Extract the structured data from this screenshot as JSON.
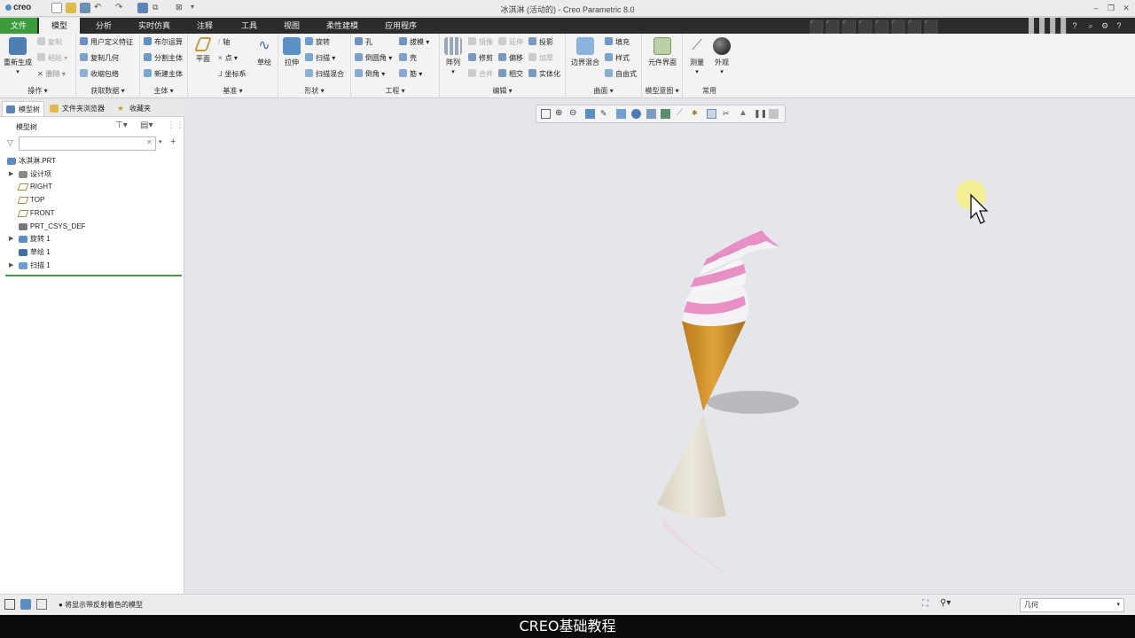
{
  "app": {
    "logo": "creo",
    "window_title": "冰淇淋 (活动的) - Creo Parametric 8.0"
  },
  "tabs": [
    "文件",
    "模型",
    "分析",
    "实时仿真",
    "注释",
    "工具",
    "视图",
    "柔性建模",
    "应用程序"
  ],
  "ribbon": {
    "operations": {
      "label": "操作",
      "regen": "重新生成",
      "copy": "复制",
      "paste": "粘贴",
      "delete": "删除"
    },
    "getdata": {
      "label": "获取数据",
      "udf": "用户定义特征",
      "copygeom": "复制几何",
      "shrinkwrap": "收缩包络"
    },
    "body": {
      "label": "主体",
      "boolean": "布尔运算",
      "split": "分割主体",
      "newbody": "新建主体"
    },
    "datum": {
      "label": "基准",
      "plane": "平面",
      "axis": "轴",
      "point": "点",
      "csys": "坐标系",
      "sketch": "草绘"
    },
    "shapes": {
      "label": "形状",
      "extrude": "拉伸",
      "revolve": "旋转",
      "sweep": "扫描",
      "swept_blend": "扫描混合"
    },
    "engineering": {
      "label": "工程",
      "hole": "孔",
      "round": "倒圆角",
      "chamfer": "倒角",
      "draft": "拔模",
      "shell": "壳",
      "rib": "筋"
    },
    "editing": {
      "label": "编辑",
      "pattern": "阵列",
      "mirror": "镜像",
      "extend": "延伸",
      "project": "投影",
      "trim": "修剪",
      "offset": "偏移",
      "thicken": "加厚",
      "merge": "合并",
      "intersect": "相交",
      "solidify": "实体化"
    },
    "surfaces": {
      "label": "曲面",
      "boundary": "边界混合",
      "fill": "填充",
      "style": "样式",
      "freestyle": "自由式"
    },
    "intent": {
      "label": "模型意图",
      "component_interface": "元件界面"
    },
    "common": {
      "label": "常用",
      "measure": "测量",
      "appearance": "外观"
    }
  },
  "panel": {
    "tabs": [
      "模型树",
      "文件夹浏览器",
      "收藏夹"
    ],
    "tree_title": "模型树",
    "search_value": "",
    "items": [
      {
        "label": "冰淇淋.PRT",
        "expandable": false,
        "icon": "part-icon"
      },
      {
        "label": "设计项",
        "expandable": true,
        "icon": "design-items-icon"
      },
      {
        "label": "RIGHT",
        "expandable": false,
        "icon": "datum-plane-icon"
      },
      {
        "label": "TOP",
        "expandable": false,
        "icon": "datum-plane-icon"
      },
      {
        "label": "FRONT",
        "expandable": false,
        "icon": "datum-plane-icon"
      },
      {
        "label": "PRT_CSYS_DEF",
        "expandable": false,
        "icon": "csys-icon"
      },
      {
        "label": "旋转 1",
        "expandable": true,
        "icon": "revolve-icon"
      },
      {
        "label": "草绘 1",
        "expandable": false,
        "icon": "sketch-icon"
      },
      {
        "label": "扫描 1",
        "expandable": true,
        "icon": "sweep-icon"
      }
    ]
  },
  "status": {
    "message": "将显示带反射着色的模型",
    "filter": "几何"
  },
  "caption": "CREO基础教程",
  "colors": {
    "tab_bar": "#2b2b2b",
    "file_tab": "#3c9c3c",
    "cone": "#d4922a",
    "cream_pink": "#e890c6",
    "cursor_highlight": "#f5f08c"
  }
}
